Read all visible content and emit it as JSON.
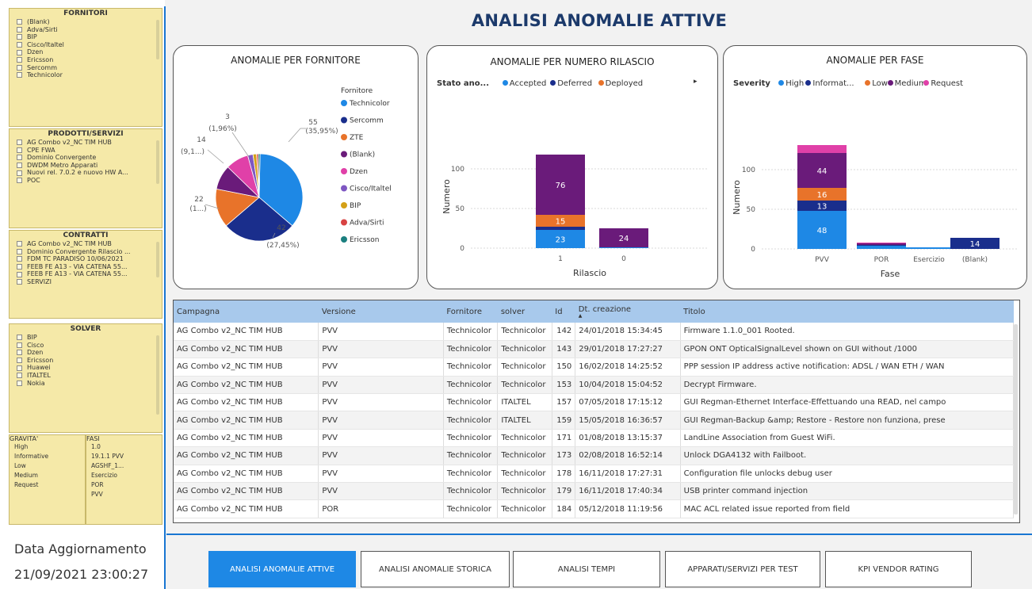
{
  "page": {
    "title": "ANALISI ANOMALIE ATTIVE"
  },
  "slicers": {
    "fornitori": {
      "title": "FORNITORI",
      "items": [
        "(Blank)",
        "Adva/Sirti",
        "BIP",
        "Cisco/Italtel",
        "Dzen",
        "Ericsson",
        "Sercomm",
        "Technicolor"
      ]
    },
    "prodotti": {
      "title": "PRODOTTI/SERVIZI",
      "items": [
        "AG Combo v2_NC TIM HUB",
        "CPE FWA",
        "Dominio Convergente",
        "DWDM Metro Apparati",
        "Nuovi rel. 7.0.2 e nuovo HW A...",
        "POC"
      ]
    },
    "contratti": {
      "title": "CONTRATTI",
      "items": [
        "AG Combo v2_NC TIM HUB",
        "Dominio Convergente Rilascio ...",
        "FDM TC PARADISO 10/06/2021",
        "FEEB FE A13 - VIA CATENA 55...",
        "FEEB FE A13 - VIA CATENA 55...",
        "SERVIZI"
      ]
    },
    "solver": {
      "title": "SOLVER",
      "items": [
        "BIP",
        "Cisco",
        "Dzen",
        "Ericsson",
        "Huawei",
        "ITALTEL",
        "Nokia"
      ]
    },
    "gravita": {
      "title": "GRAVITA'",
      "items": [
        "High",
        "Informative",
        "Low",
        "Medium",
        "Request"
      ]
    },
    "fasi": {
      "title": "FASI",
      "items": [
        "1.0",
        "19.1.1 PVV",
        "AGSHF_1...",
        "Esercizio",
        "POR",
        "PVV"
      ]
    }
  },
  "update": {
    "label": "Data Aggiornamento",
    "value": "21/09/2021 23:00:27"
  },
  "pie": {
    "title": "ANOMALIE PER FORNITORE",
    "legend_title": "Fornitore",
    "legend": [
      {
        "name": "Technicolor",
        "color": "#1e88e5"
      },
      {
        "name": "Sercomm",
        "color": "#1a2e8c"
      },
      {
        "name": "ZTE",
        "color": "#e8732a"
      },
      {
        "name": "(Blank)",
        "color": "#6a1b7a"
      },
      {
        "name": "Dzen",
        "color": "#e040a8"
      },
      {
        "name": "Cisco/Italtel",
        "color": "#7e57c2"
      },
      {
        "name": "BIP",
        "color": "#d4a017"
      },
      {
        "name": "Adva/Sirti",
        "color": "#d84343"
      },
      {
        "name": "Ericsson",
        "color": "#1b7f7f"
      }
    ],
    "labels": {
      "l55": "55",
      "l55p": "(35,95%)",
      "l42": "42",
      "l42p": "(27,45%)",
      "l22": "22",
      "l22p": "(1...)",
      "l14": "14",
      "l14p": "(9,1...)",
      "l3": "3",
      "l3p": "(1,96%)"
    }
  },
  "chart_data": [
    {
      "type": "pie",
      "title": "ANOMALIE PER FORNITORE",
      "legend_title": "Fornitore",
      "slices": [
        {
          "name": "Technicolor",
          "value": 55
        },
        {
          "name": "Sercomm",
          "value": 42
        },
        {
          "name": "ZTE",
          "value": 22
        },
        {
          "name": "(Blank)",
          "value": 14
        },
        {
          "name": "Dzen",
          "value": 13
        },
        {
          "name": "Cisco/Italtel",
          "value": 3
        },
        {
          "name": "BIP",
          "value": 2
        },
        {
          "name": "Adva/Sirti",
          "value": 1
        },
        {
          "name": "Ericsson",
          "value": 1
        }
      ],
      "percent_labels": {
        "Technicolor": "35,95%",
        "Sercomm": "27,45%",
        "(Blank)": "9,1...",
        "Cisco/Italtel": "1,96%"
      }
    },
    {
      "type": "bar",
      "stacked": true,
      "title": "ANOMALIE PER NUMERO RILASCIO",
      "legend_title": "Stato ano...",
      "xlabel": "Rilascio",
      "ylabel": "Numero",
      "categories": [
        "1",
        "0"
      ],
      "ylim": [
        0,
        130
      ],
      "yticks": [
        0,
        50,
        100
      ],
      "series": [
        {
          "name": "Accepted",
          "color": "#1e88e5",
          "values": [
            23,
            1
          ]
        },
        {
          "name": "Deferred",
          "color": "#1a2e8c",
          "values": [
            4,
            0
          ]
        },
        {
          "name": "Deployed",
          "color": "#e8732a",
          "values": [
            15,
            0
          ]
        },
        {
          "name": "",
          "color": "#6a1b7a",
          "values": [
            76,
            24
          ]
        }
      ],
      "data_labels": [
        [
          "23",
          "",
          "15",
          "76"
        ],
        [
          "",
          "",
          "",
          "24"
        ]
      ]
    },
    {
      "type": "bar",
      "stacked": true,
      "title": "ANOMALIE PER FASE",
      "legend_title": "Severity",
      "xlabel": "Fase",
      "ylabel": "Numero",
      "categories": [
        "PVV",
        "POR",
        "Esercizio",
        "(Blank)"
      ],
      "ylim": [
        0,
        130
      ],
      "yticks": [
        0,
        50,
        100
      ],
      "series": [
        {
          "name": "High",
          "color": "#1e88e5",
          "values": [
            48,
            4,
            2,
            0
          ]
        },
        {
          "name": "Informat...",
          "color": "#1a2e8c",
          "values": [
            13,
            1,
            0,
            14
          ]
        },
        {
          "name": "Low",
          "color": "#e8732a",
          "values": [
            16,
            0,
            0,
            0
          ]
        },
        {
          "name": "Medium",
          "color": "#6a1b7a",
          "values": [
            44,
            2,
            0,
            0
          ]
        },
        {
          "name": "Request",
          "color": "#e040a8",
          "values": [
            10,
            1,
            0,
            0
          ]
        }
      ],
      "data_labels": [
        [
          "48",
          "13",
          "16",
          "44",
          ""
        ],
        [
          "",
          "",
          "",
          "",
          ""
        ],
        [
          "",
          "",
          "",
          "",
          ""
        ],
        [
          "",
          "14",
          "",
          "",
          ""
        ]
      ]
    }
  ],
  "bar1": {
    "title": "ANOMALIE PER NUMERO RILASCIO",
    "legend_title": "Stato ano...",
    "legend": [
      {
        "name": "Accepted",
        "color": "#1e88e5"
      },
      {
        "name": "Deferred",
        "color": "#1a2e8c"
      },
      {
        "name": "Deployed",
        "color": "#e8732a"
      }
    ],
    "xlabel": "Rilascio",
    "ylabel": "Numero"
  },
  "bar2": {
    "title": "ANOMALIE PER FASE",
    "legend_title": "Severity",
    "legend": [
      {
        "name": "High",
        "color": "#1e88e5"
      },
      {
        "name": "Informat...",
        "color": "#1a2e8c"
      },
      {
        "name": "Low",
        "color": "#e8732a"
      },
      {
        "name": "Medium",
        "color": "#6a1b7a"
      },
      {
        "name": "Request",
        "color": "#e040a8"
      }
    ],
    "xlabel": "Fase",
    "ylabel": "Numero"
  },
  "table": {
    "columns": [
      "Campagna",
      "Versione",
      "Fornitore",
      "solver",
      "Id",
      "Dt. creazione",
      "Titolo"
    ],
    "rows": [
      [
        "AG Combo v2_NC TIM HUB",
        "PVV",
        "Technicolor",
        "Technicolor",
        "142",
        "24/01/2018 15:34:45",
        "Firmware 1.1.0_001 Rooted."
      ],
      [
        "AG Combo v2_NC TIM HUB",
        "PVV",
        "Technicolor",
        "Technicolor",
        "143",
        "29/01/2018 17:27:27",
        "GPON ONT OpticalSignalLevel shown on GUI without /1000"
      ],
      [
        "AG Combo v2_NC TIM HUB",
        "PVV",
        "Technicolor",
        "Technicolor",
        "150",
        "16/02/2018 14:25:52",
        "PPP session IP address active notification: ADSL / WAN ETH / WAN"
      ],
      [
        "AG Combo v2_NC TIM HUB",
        "PVV",
        "Technicolor",
        "Technicolor",
        "153",
        "10/04/2018 15:04:52",
        "Decrypt Firmware."
      ],
      [
        "AG Combo v2_NC TIM HUB",
        "PVV",
        "Technicolor",
        "ITALTEL",
        "157",
        "07/05/2018 17:15:12",
        "GUI Regman-Ethernet Interface-Effettuando una READ, nel campo"
      ],
      [
        "AG Combo v2_NC TIM HUB",
        "PVV",
        "Technicolor",
        "ITALTEL",
        "159",
        "15/05/2018 16:36:57",
        "GUI Regman-Backup &amp; Restore - Restore non funziona, prese"
      ],
      [
        "AG Combo v2_NC TIM HUB",
        "PVV",
        "Technicolor",
        "Technicolor",
        "171",
        "01/08/2018 13:15:37",
        "LandLine Association from Guest WiFi."
      ],
      [
        "AG Combo v2_NC TIM HUB",
        "PVV",
        "Technicolor",
        "Technicolor",
        "173",
        "02/08/2018 16:52:14",
        "Unlock DGA4132 with Failboot."
      ],
      [
        "AG Combo v2_NC TIM HUB",
        "PVV",
        "Technicolor",
        "Technicolor",
        "178",
        "16/11/2018 17:27:31",
        "Configuration file unlocks debug user"
      ],
      [
        "AG Combo v2_NC TIM HUB",
        "PVV",
        "Technicolor",
        "Technicolor",
        "179",
        "16/11/2018 17:40:34",
        "USB printer command injection"
      ],
      [
        "AG Combo v2_NC TIM HUB",
        "POR",
        "Technicolor",
        "Technicolor",
        "184",
        "05/12/2018 11:19:56",
        "MAC ACL related issue reported from field"
      ]
    ]
  },
  "nav": [
    "ANALISI ANOMALIE ATTIVE",
    "ANALISI ANOMALIE STORICA",
    "ANALISI TEMPI",
    "APPARATI/SERVIZI PER TEST",
    "KPI VENDOR RATING"
  ]
}
